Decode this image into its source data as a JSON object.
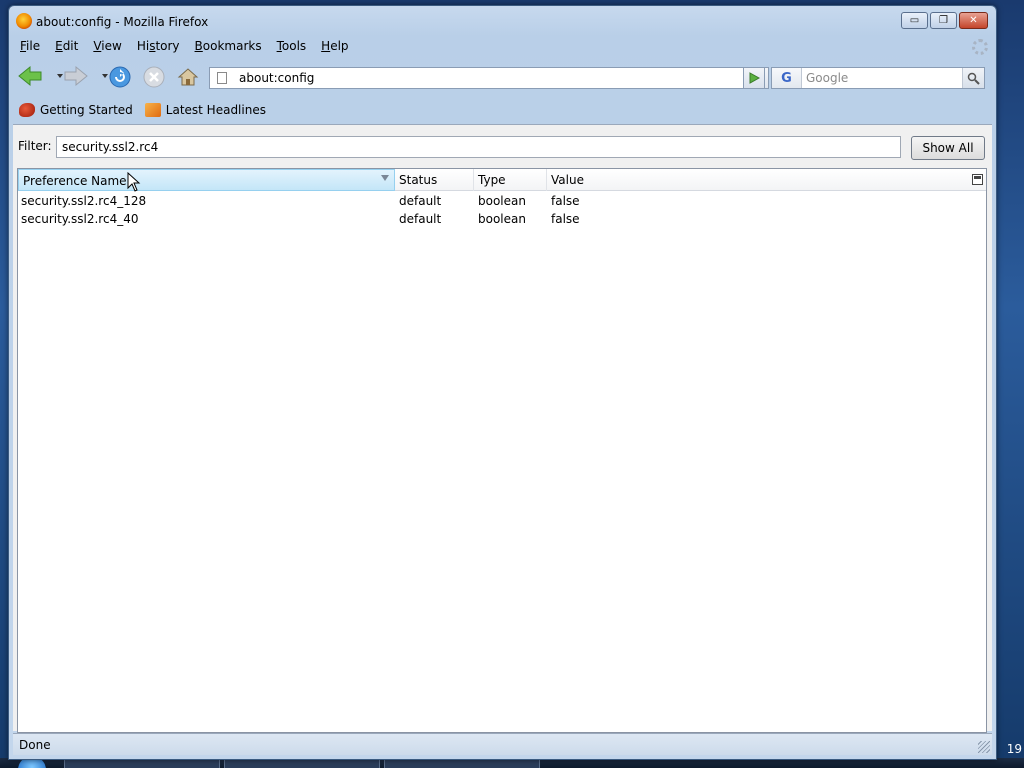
{
  "window": {
    "title": "about:config - Mozilla Firefox",
    "controls": {
      "minimize": "▭",
      "maximize": "❐",
      "close": "✕"
    }
  },
  "menu": {
    "items": [
      {
        "label": "File",
        "accesskey": "F",
        "rest": "ile"
      },
      {
        "label": "Edit",
        "accesskey": "E",
        "rest": "dit"
      },
      {
        "label": "View",
        "accesskey": "V",
        "rest": "iew"
      },
      {
        "label": "History",
        "accesskey": "s",
        "pre": "Hi",
        "rest": "tory"
      },
      {
        "label": "Bookmarks",
        "accesskey": "B",
        "rest": "ookmarks"
      },
      {
        "label": "Tools",
        "accesskey": "T",
        "rest": "ools"
      },
      {
        "label": "Help",
        "accesskey": "H",
        "rest": "elp"
      }
    ]
  },
  "navbar": {
    "url": "about:config",
    "search_placeholder": "Google",
    "search_engine_glyph": "G"
  },
  "bookmarks": {
    "items": [
      {
        "label": "Getting Started",
        "icon": "firefox-icon"
      },
      {
        "label": "Latest Headlines",
        "icon": "rss-icon"
      }
    ]
  },
  "config": {
    "filter_label": "Filter:",
    "filter_value": "security.ssl2.rc4",
    "show_all_label": "Show All",
    "columns": {
      "name": "Preference Name",
      "status": "Status",
      "type": "Type",
      "value": "Value"
    },
    "rows": [
      {
        "name": "security.ssl2.rc4_128",
        "status": "default",
        "type": "boolean",
        "value": "false"
      },
      {
        "name": "security.ssl2.rc4_40",
        "status": "default",
        "type": "boolean",
        "value": "false"
      }
    ]
  },
  "status": {
    "text": "Done"
  },
  "taskbar": {
    "clock": "19"
  },
  "colors": {
    "sorted_header_bg": "#c4e6f8",
    "window_chrome": "#c3d6ec",
    "close_button": "#c4452b"
  }
}
